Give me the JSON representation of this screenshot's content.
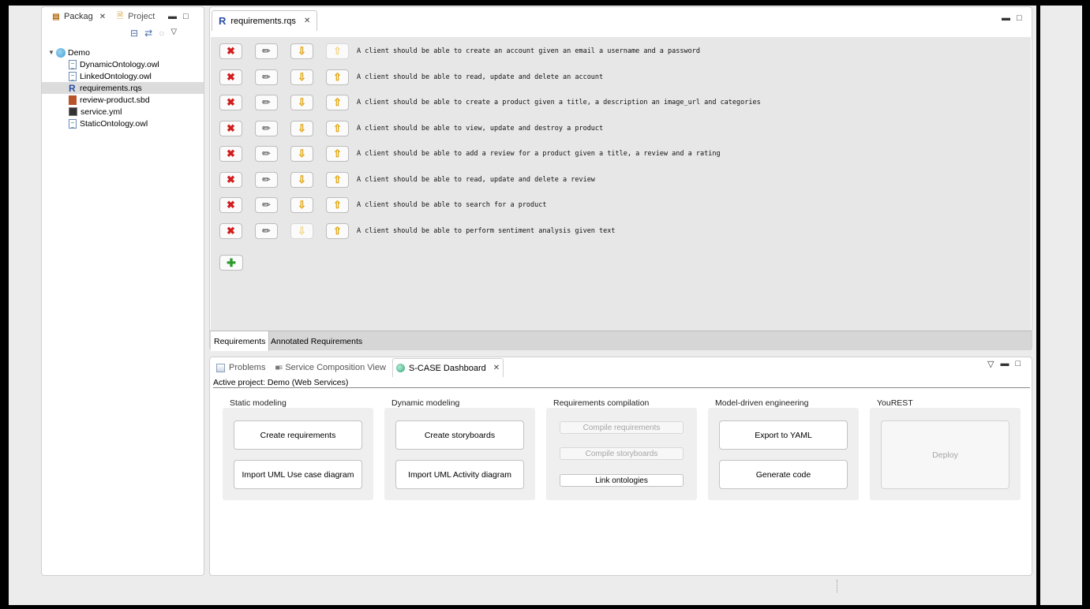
{
  "package_explorer": {
    "tabs": [
      {
        "label": "Packag",
        "icon": "package-icon"
      },
      {
        "label": "Project",
        "icon": "project-folder-icon"
      }
    ],
    "tree": {
      "root": "Demo",
      "files": [
        {
          "name": "DynamicOntology.owl",
          "icon": "file-icon"
        },
        {
          "name": "LinkedOntology.owl",
          "icon": "file-icon"
        },
        {
          "name": "requirements.rqs",
          "icon": "r-file-icon",
          "selected": true
        },
        {
          "name": "review-product.sbd",
          "icon": "storyboard-icon"
        },
        {
          "name": "service.yml",
          "icon": "yaml-icon"
        },
        {
          "name": "StaticOntology.owl",
          "icon": "file-icon"
        }
      ]
    }
  },
  "editor": {
    "tab_label": "requirements.rqs",
    "requirements": [
      {
        "text": "A client should be able to create an account given an email a username and a password",
        "up_enabled": false,
        "down_enabled": true
      },
      {
        "text": "A client should be able to read, update and delete an account",
        "up_enabled": true,
        "down_enabled": true
      },
      {
        "text": "A client should be able to create a product given a title, a description an image_url and categories",
        "up_enabled": true,
        "down_enabled": true
      },
      {
        "text": "A client should be able to view, update and destroy a product",
        "up_enabled": true,
        "down_enabled": true
      },
      {
        "text": "A client should be able to add a review for a product given a title, a review and a rating",
        "up_enabled": true,
        "down_enabled": true
      },
      {
        "text": "A client should be able to read, update and delete a review",
        "up_enabled": true,
        "down_enabled": true
      },
      {
        "text": "A client should be able to search for a product",
        "up_enabled": true,
        "down_enabled": true
      },
      {
        "text": "A client should be able to perform sentiment analysis given text",
        "up_enabled": true,
        "down_enabled": false
      }
    ],
    "bottom_tabs": [
      "Requirements",
      "Annotated Requirements"
    ]
  },
  "dashboard": {
    "tabs": [
      {
        "label": "Problems",
        "icon": "problems-icon"
      },
      {
        "label": "Service Composition View",
        "icon": "composition-icon"
      },
      {
        "label": "S-CASE Dashboard",
        "icon": "dashboard-icon"
      }
    ],
    "active_project": "Active project: Demo (Web Services)",
    "groups": {
      "static": {
        "title": "Static modeling",
        "b1": "Create requirements",
        "b2": "Import UML Use case diagram"
      },
      "dynamic": {
        "title": "Dynamic modeling",
        "b1": "Create storyboards",
        "b2": "Import UML Activity diagram"
      },
      "compile": {
        "title": "Requirements compilation",
        "b1": "Compile requirements",
        "b2": "Compile storyboards",
        "b3": "Link ontologies"
      },
      "mde": {
        "title": "Model-driven engineering",
        "b1": "Export to YAML",
        "b2": "Generate code"
      },
      "yourest": {
        "title": "YouREST",
        "b1": "Deploy"
      }
    }
  },
  "colors": {
    "delete": "#d11d1d",
    "arrow": "#e0a000",
    "add": "#2c9a2c",
    "link": "#2a4fa5"
  }
}
